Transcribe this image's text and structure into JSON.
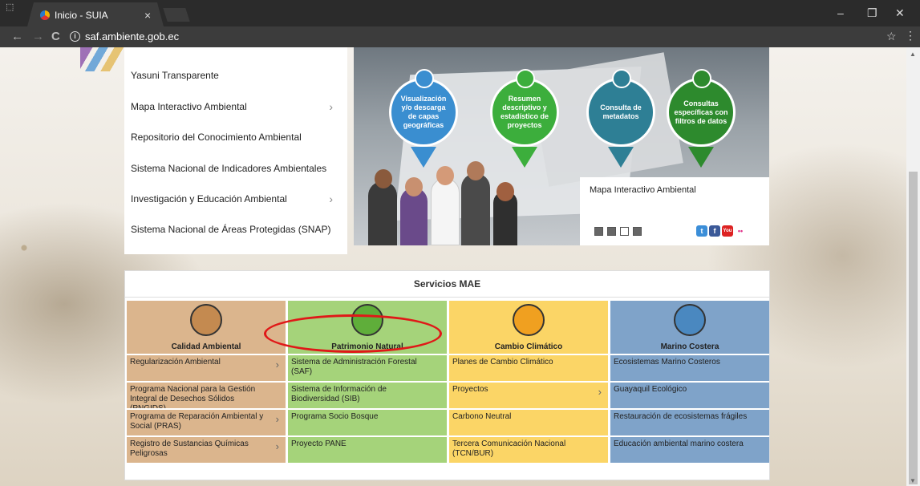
{
  "browser": {
    "incognito_icon": "incognito-icon",
    "tab_title": "Inicio - SUIA",
    "tab_close": "×",
    "url": "saf.ambiente.gob.ec",
    "icons": {
      "back": "←",
      "forward": "→",
      "reload": "C",
      "info": "i",
      "star": "☆",
      "menu": "⋮",
      "minimize": "–",
      "restore": "❐",
      "close": "✕"
    }
  },
  "menu": {
    "items": [
      {
        "label": "Yasuni Transparente",
        "chevron": ""
      },
      {
        "label": "Mapa Interactivo Ambiental",
        "chevron": "›"
      },
      {
        "label": "Repositorio del Conocimiento Ambiental",
        "chevron": ""
      },
      {
        "label": "Sistema Nacional de Indicadores Ambientales",
        "chevron": ""
      },
      {
        "label": "Investigación y Educación Ambiental",
        "chevron": "›"
      },
      {
        "label": "Sistema Nacional de Áreas Protegidas (SNAP)",
        "chevron": ""
      }
    ]
  },
  "banner": {
    "pins": [
      {
        "text": "Visualización y/o descarga de capas geográficas",
        "color": "#3a8ed0"
      },
      {
        "text": "Resumen descriptivo y estadístico de proyectos",
        "color": "#3cae3c"
      },
      {
        "text": "Consulta de metadatos",
        "color": "#2e7f95"
      },
      {
        "text": "Consultas específicas con filtros de datos",
        "color": "#2d8a2d"
      }
    ],
    "caption": "Mapa Interactivo Ambiental",
    "social": {
      "twitter": "t",
      "facebook": "f",
      "youtube": "You",
      "flickr": "••"
    }
  },
  "services": {
    "title": "Servicios MAE",
    "columns": [
      {
        "title": "Calidad Ambiental",
        "color": "#dbb58d",
        "icon": "factory-tree-icon",
        "items": [
          {
            "label": "Regularización Ambiental",
            "chevron": "›"
          },
          {
            "label": "Programa Nacional para la Gestión Integral de Desechos Sólidos (PNGIDS)",
            "chevron": ""
          },
          {
            "label": "Programa de Reparación Ambiental y Social (PRAS)",
            "chevron": "›"
          },
          {
            "label": "Registro de Sustancias Químicas Peligrosas",
            "chevron": "›"
          }
        ]
      },
      {
        "title": "Patrimonio Natural",
        "color": "#a5d37a",
        "icon": "leaf-icon",
        "items": [
          {
            "label": "Sistema de Administración Forestal (SAF)",
            "chevron": ""
          },
          {
            "label": "Sistema de Información de Biodiversidad (SIB)",
            "chevron": ""
          },
          {
            "label": "Programa Socio Bosque",
            "chevron": ""
          },
          {
            "label": "Proyecto PANE",
            "chevron": ""
          }
        ]
      },
      {
        "title": "Cambio Climático",
        "color": "#fbd566",
        "icon": "sun-cloud-icon",
        "items": [
          {
            "label": "Planes de Cambio Climático",
            "chevron": ""
          },
          {
            "label": "Proyectos",
            "chevron": "›"
          },
          {
            "label": "Carbono Neutral",
            "chevron": ""
          },
          {
            "label": "Tercera Comunicación Nacional (TCN/BUR)",
            "chevron": ""
          }
        ]
      },
      {
        "title": "Marino Costera",
        "color": "#7fa3c9",
        "icon": "coast-icon",
        "items": [
          {
            "label": "Ecosistemas Marino Costeros",
            "chevron": ""
          },
          {
            "label": "Guayaquil Ecológico",
            "chevron": ""
          },
          {
            "label": "Restauración de ecosistemas frágiles",
            "chevron": ""
          },
          {
            "label": "Educación ambiental marino costera",
            "chevron": ""
          }
        ]
      }
    ]
  }
}
